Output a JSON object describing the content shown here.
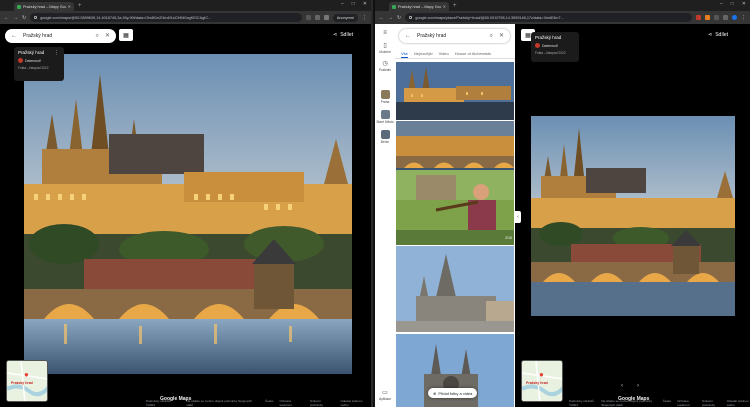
{
  "left": {
    "tab_title": "Pražský hrad – Mapy Google",
    "url": "google.com/maps/@50.0899639,14.4016745,3a,90y,90t/data=!3m8!1e2!3m6!1sCIHM0ogKEICAgIC...",
    "incognito_label": "Anonymní",
    "search_query": "Pražský hrad",
    "share_label": "Sdílet",
    "info": {
      "title": "Pražský hrad",
      "author": "Datenwolf",
      "meta": "Fotka – listopad 2022"
    },
    "footer": {
      "brand": "Google Maps",
      "links": [
        "Podmínky obrázků ©2023",
        "Na obálce se mohou objevit podmínky Spojených států",
        "Česko",
        "Ochrana soukromí",
        "Smluvní podmínky",
        "Odeslat zpětnou vazbu"
      ]
    },
    "mini_map_label": "Pražský hrad"
  },
  "right": {
    "tab_title": "Pražský hrad – Mapy Google",
    "url": "google.com/maps/place/Pražský+hrad/@50.0910798,14.3959148,17z/data=!4m8!3m7...",
    "search_query": "Pražský hrad",
    "share_label": "Sdílet",
    "rail": [
      {
        "icon": "bookmark-icon",
        "label": "Uložené"
      },
      {
        "icon": "history-icon",
        "label": "Poslední"
      },
      {
        "icon": "place-thumb",
        "label": "Praha"
      },
      {
        "icon": "place-thumb",
        "label": "Staré Město"
      },
      {
        "icon": "place-thumb",
        "label": "Berlín"
      },
      {
        "icon": "phone-icon",
        "label": "Aplikace"
      }
    ],
    "photo_tabs": [
      "Vše",
      "Nejnovější",
      "Video",
      "House of Alchemists"
    ],
    "photo_counter": "2/10",
    "add_photo_label": "Přidat fotky a videa",
    "info": {
      "title": "Pražský hrad",
      "author": "Datenwolf",
      "meta": "Fotka – listopad 2022"
    },
    "footer": {
      "brand": "Google Maps",
      "links": [
        "Podmínky obrázků ©2023",
        "Na obálce se mohou objevit podmínky Spojených států",
        "Česko",
        "Ochrana soukromí",
        "Smluvní podmínky",
        "Odeslat zpětnou vazbu"
      ]
    },
    "mini_map_label": "Pražský hrad"
  },
  "colors": {
    "map_blue": "#1a73e8",
    "accent": "#0b57d0",
    "sky_top": "#6b8fb3",
    "castle_gold": "#d9a04a"
  }
}
